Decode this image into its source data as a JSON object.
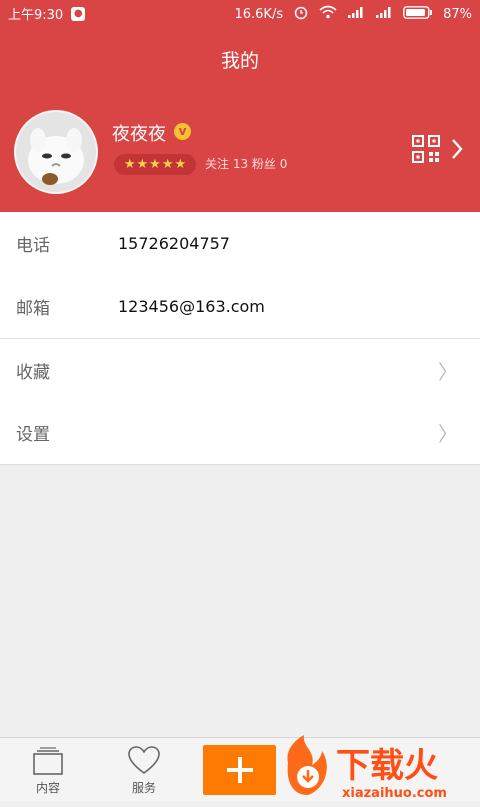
{
  "status": {
    "time": "上午9:30",
    "speed": "16.6K/s",
    "battery": "87%"
  },
  "header": {
    "title": "我的",
    "user": {
      "name": "夜夜夜",
      "badge": "v",
      "rating_stars": 5,
      "follow_text": "关注 13  粉丝 0"
    }
  },
  "profile_rows": [
    {
      "label": "电话",
      "value": "15726204757"
    },
    {
      "label": "邮箱",
      "value": "123456@163.com"
    },
    {
      "label": "收藏",
      "chevron": "〉"
    },
    {
      "label": "设置",
      "chevron": "〉"
    }
  ],
  "tabs": [
    {
      "label": "内容",
      "icon": "content-icon"
    },
    {
      "label": "服务",
      "icon": "heart-icon"
    }
  ],
  "watermark": {
    "name": "下载火",
    "url": "xiazaihuo.com"
  },
  "colors": {
    "header_red": "#d94445",
    "accent_orange": "#ff7a00",
    "star_yellow": "#f7d04a"
  }
}
